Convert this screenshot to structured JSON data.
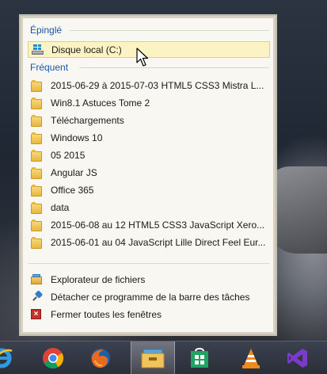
{
  "jumplist": {
    "pinned_heading": "Épinglé",
    "pinned_items": [
      {
        "label": "Disque local (C:)",
        "icon": "drive-icon"
      }
    ],
    "frequent_heading": "Fréquent",
    "frequent_items": [
      {
        "label": "2015-06-29 à 2015-07-03 HTML5 CSS3 Mistra L...",
        "icon": "folder-icon"
      },
      {
        "label": "Win8.1 Astuces Tome 2",
        "icon": "folder-icon"
      },
      {
        "label": "Téléchargements",
        "icon": "folder-icon"
      },
      {
        "label": "Windows 10",
        "icon": "folder-icon"
      },
      {
        "label": "05 2015",
        "icon": "folder-icon"
      },
      {
        "label": "Angular JS",
        "icon": "folder-icon"
      },
      {
        "label": "Office 365",
        "icon": "folder-icon"
      },
      {
        "label": "data",
        "icon": "folder-icon"
      },
      {
        "label": "2015-06-08 au 12 HTML5 CSS3 JavaScript Xero...",
        "icon": "folder-icon"
      },
      {
        "label": "2015-06-01 au 04 JavaScript Lille Direct Feel Eur...",
        "icon": "folder-icon"
      }
    ],
    "tasks": [
      {
        "label": "Explorateur de fichiers",
        "icon": "file-explorer-icon"
      },
      {
        "label": "Détacher ce programme de la barre des tâches",
        "icon": "unpin-icon"
      },
      {
        "label": "Fermer toutes les fenêtres",
        "icon": "close-all-icon"
      }
    ]
  },
  "taskbar": {
    "apps": [
      {
        "name": "Internet Explorer",
        "icon": "internet-explorer-icon"
      },
      {
        "name": "Google Chrome",
        "icon": "chrome-icon"
      },
      {
        "name": "Firefox",
        "icon": "firefox-icon"
      },
      {
        "name": "Explorateur de fichiers",
        "icon": "file-explorer-icon",
        "active": true
      },
      {
        "name": "Windows Store",
        "icon": "store-icon"
      },
      {
        "name": "VLC",
        "icon": "vlc-icon"
      },
      {
        "name": "Visual Studio",
        "icon": "visual-studio-icon"
      }
    ]
  },
  "colors": {
    "heading": "#1b56a6",
    "selected_bg": "#fcf3c4",
    "panel_bg": "#f8f7f1"
  }
}
